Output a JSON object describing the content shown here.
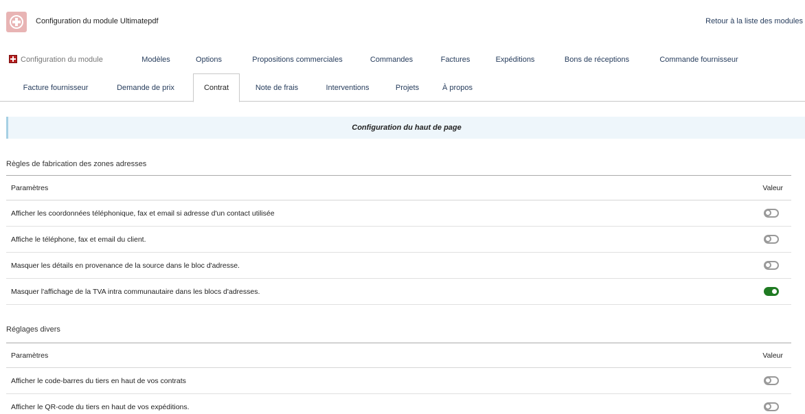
{
  "header": {
    "module_title": "Configuration du module Ultimatepdf",
    "back_link": "Retour à la liste des modules"
  },
  "tabs": {
    "row1": [
      {
        "label": "Configuration du module",
        "icon": "module-config-icon"
      },
      {
        "label": "Modèles"
      },
      {
        "label": "Options"
      },
      {
        "label": "Propositions commerciales"
      },
      {
        "label": "Commandes"
      },
      {
        "label": "Factures"
      },
      {
        "label": "Expéditions"
      },
      {
        "label": "Bons de réceptions"
      },
      {
        "label": "Commande fournisseur"
      }
    ],
    "row2": [
      {
        "label": "Facture fournisseur"
      },
      {
        "label": "Demande de prix"
      },
      {
        "label": "Contrat",
        "active": true
      },
      {
        "label": "Note de frais"
      },
      {
        "label": "Interventions"
      },
      {
        "label": "Projets"
      },
      {
        "label": "À propos"
      }
    ]
  },
  "banner": {
    "title": "Configuration du haut de page"
  },
  "group1": {
    "title": "Règles de fabrication des zones adresses",
    "header_param": "Paramètres",
    "header_value": "Valeur",
    "rows": [
      {
        "label": "Afficher les coordonnées téléphonique, fax et email si adresse d'un contact utilisée",
        "enabled": false
      },
      {
        "label": "Affiche le téléphone, fax et email du client.",
        "enabled": false
      },
      {
        "label": "Masquer les détails en provenance de la source dans le bloc d'adresse.",
        "enabled": false
      },
      {
        "label": "Masquer l'affichage de la TVA intra communautaire dans les blocs d'adresses.",
        "enabled": true
      }
    ]
  },
  "group2": {
    "title": "Réglages divers",
    "header_param": "Paramètres",
    "header_value": "Valeur",
    "rows": [
      {
        "label": "Afficher le code-barres du tiers en haut de vos contrats",
        "enabled": false
      },
      {
        "label": "Afficher le QR-code du tiers en haut de vos expéditions.",
        "enabled": false
      }
    ]
  },
  "colors": {
    "link": "#263c5c",
    "toggle_on": "#1f7a22",
    "toggle_off": "#999999",
    "banner_bg": "#eef6fb",
    "banner_border": "#a6d0e4"
  }
}
